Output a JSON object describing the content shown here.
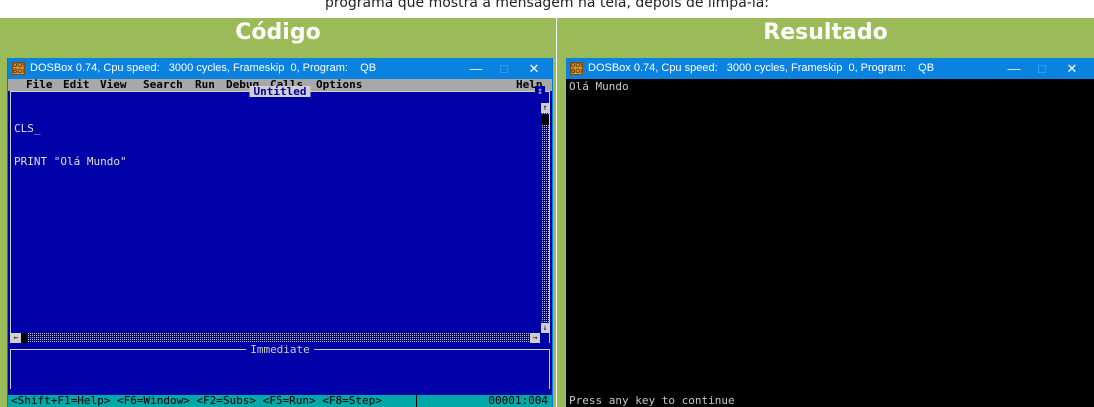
{
  "top_strip_text": "programa que mostra a mensagem na tela, depois de limpá-la:",
  "left_panel": {
    "header": "Código",
    "window": {
      "title": "DOSBox 0.74, Cpu speed:   3000 cycles, Frameskip  0, Program:    QB",
      "minimize": "—",
      "maximize": "□",
      "close": "✕",
      "icon_text": "DOS BOX"
    },
    "menu": [
      "File",
      "Edit",
      "View",
      "Search",
      "Run",
      "Debug",
      "Calls",
      "Options",
      "Help"
    ],
    "editor": {
      "doc_title": "Untitled",
      "lines": [
        "CLS_",
        "PRINT \"Olá Mundo\""
      ],
      "scroll_up": "↑",
      "scroll_down": "↓",
      "scroll_left": "←",
      "scroll_right": "→",
      "max_box": "↕"
    },
    "immediate_title": "Immediate",
    "status": {
      "shortcuts": "<Shift+F1=Help> <F6=Window> <F2=Subs> <F5=Run> <F8=Step>",
      "position": "00001:004"
    }
  },
  "right_panel": {
    "header": "Resultado",
    "window": {
      "title": "DOSBox 0.74, Cpu speed:   3000 cycles, Frameskip  0, Program:    QB",
      "minimize": "—",
      "maximize": "□",
      "close": "✕",
      "icon_text": "DOS BOX"
    },
    "output_first_line": "Olá Mundo",
    "output_last_line": "Press any key to continue"
  },
  "colors": {
    "panel_green": "#9bbb59",
    "titlebar_blue": "#0a82e0",
    "qbasic_blue": "#0000a8",
    "menu_gray": "#a8a8a8",
    "status_cyan": "#00a8a8"
  }
}
